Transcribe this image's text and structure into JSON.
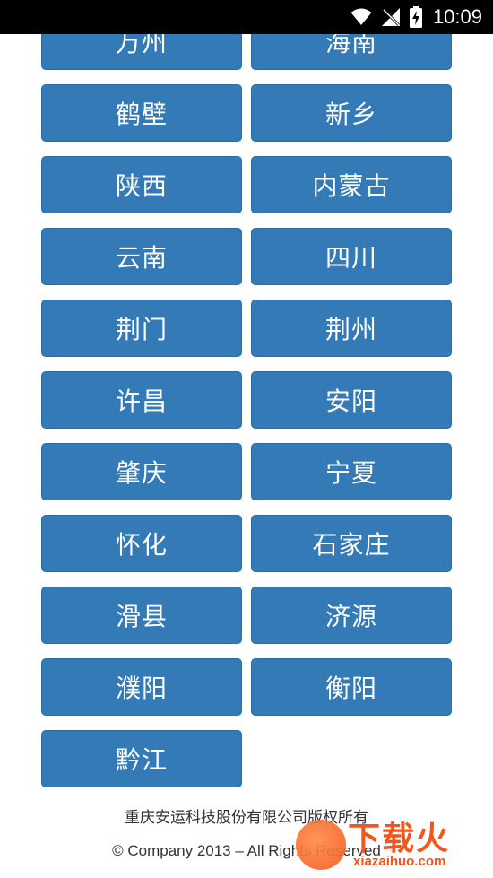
{
  "status_bar": {
    "time": "10:09",
    "icons": [
      "wifi-icon",
      "no-signal-icon",
      "battery-charging-icon"
    ]
  },
  "cities": [
    "万州",
    "海南",
    "鹤壁",
    "新乡",
    "陕西",
    "内蒙古",
    "云南",
    "四川",
    "荆门",
    "荆州",
    "许昌",
    "安阳",
    "肇庆",
    "宁夏",
    "怀化",
    "石家庄",
    "滑县",
    "济源",
    "濮阳",
    "衡阳",
    "黔江"
  ],
  "footer": {
    "company": "重庆安运科技股份有限公司版权所有",
    "copyright": "© Company 2013 – All Rights Reserved"
  },
  "watermark": {
    "title": "下载火",
    "subtitle": "xiazaihuo.com"
  },
  "colors": {
    "button_bg": "#337ab7",
    "button_text": "#ffffff",
    "status_bar_bg": "#000000",
    "watermark": "#f2561d"
  }
}
